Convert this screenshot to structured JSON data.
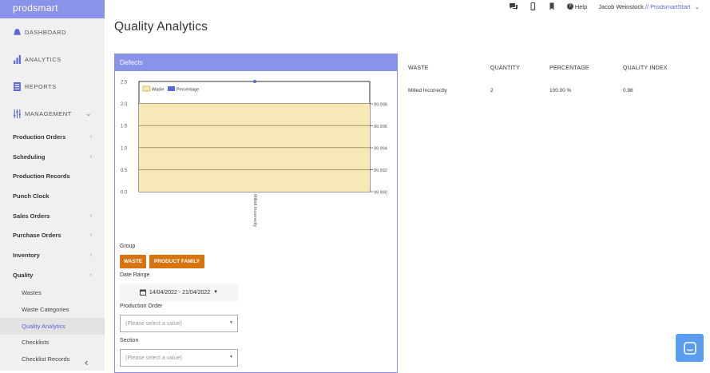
{
  "app": {
    "logo": "prodsmart"
  },
  "sidebar": {
    "top": [
      {
        "label": "DASHBOARD",
        "icon": "bell-icon"
      },
      {
        "label": "ANALYTICS",
        "icon": "bar-chart-icon"
      },
      {
        "label": "REPORTS",
        "icon": "report-icon"
      },
      {
        "label": "MANAGEMENT",
        "icon": "sliders-icon"
      }
    ],
    "items": [
      {
        "label": "Production Orders",
        "chev": "‹"
      },
      {
        "label": "Scheduling",
        "chev": "‹"
      },
      {
        "label": "Production Records",
        "chev": ""
      },
      {
        "label": "Punch Clock",
        "chev": ""
      },
      {
        "label": "Sales Orders",
        "chev": "‹"
      },
      {
        "label": "Purchase Orders",
        "chev": "‹"
      },
      {
        "label": "Inventory",
        "chev": "‹"
      },
      {
        "label": "Quality",
        "chev": "‹"
      }
    ],
    "sub": [
      "Wastes",
      "Waste Categories",
      "Quality Analytics",
      "Checklists",
      "Checklist Records"
    ],
    "collapse": "‹"
  },
  "topbar": {
    "help": "Help",
    "user": "Jacob Weinstock",
    "sep": " // ",
    "company": "ProdsmartStart",
    "caret": "⌄"
  },
  "page": {
    "title": "Quality Analytics"
  },
  "panel": {
    "title": "Defects",
    "group_label": "Group",
    "btn_waste": "WASTE",
    "btn_family": "PRODUCT FAMILY",
    "date_label": "Date Range",
    "date_value": "14/04/2022 - 21/04/2022",
    "po_label": "Production Order",
    "po_placeholder": "(Please select a value)",
    "section_label": "Section",
    "section_placeholder": "(Please select a value)"
  },
  "chart_data": {
    "type": "bar",
    "categories": [
      "Milled Incorrectly"
    ],
    "series": [
      {
        "name": "Waste",
        "values": [
          2
        ],
        "axis": "left",
        "color": "#f7e8b8"
      },
      {
        "name": "Percentage",
        "values": [
          100
        ],
        "axis": "right",
        "color": "#5a67d8"
      }
    ],
    "left_ticks": [
      "2.5",
      "2.0",
      "1.5",
      "1.0",
      "0.5",
      "0.0"
    ],
    "right_ticks": [
      "99.998",
      "99.996",
      "99.994",
      "99.992",
      "99.990"
    ],
    "ylim": [
      0,
      2.5
    ],
    "legend": "top-left"
  },
  "table": {
    "headers": [
      "WASTE",
      "QUANTITY",
      "PERCENTAGE",
      "QUALITY INDEX"
    ],
    "rows": [
      [
        "Milled Incorrectly",
        "2",
        "100.00 %",
        "0.98"
      ]
    ]
  }
}
